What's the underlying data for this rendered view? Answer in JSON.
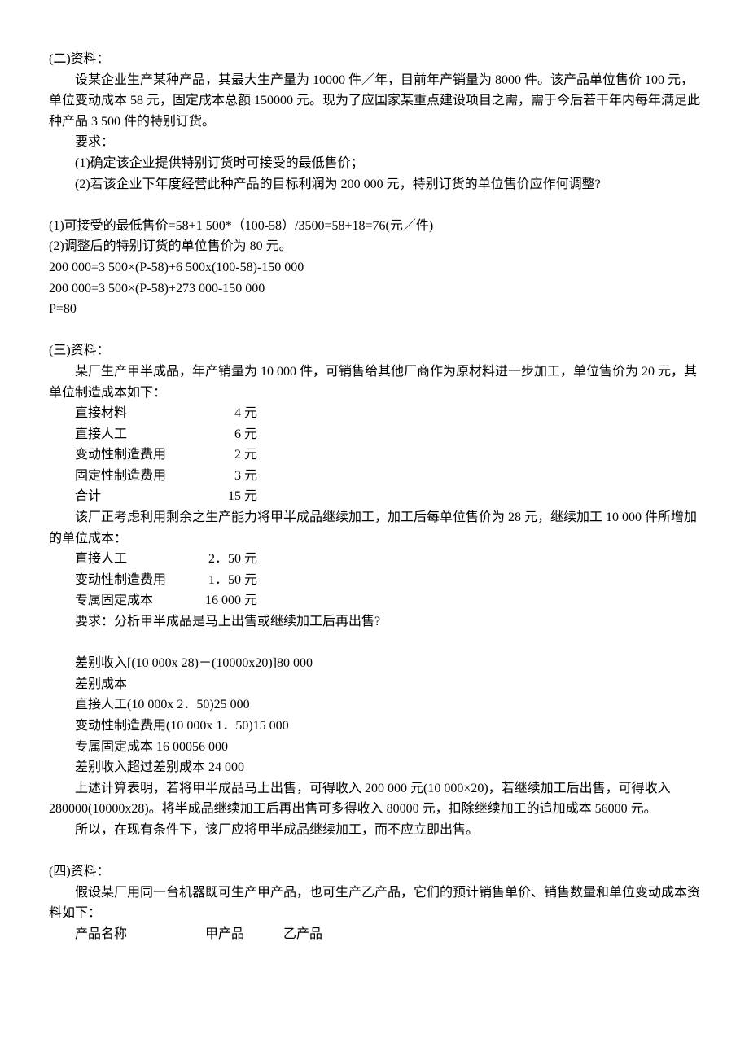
{
  "s2": {
    "title": "(二)资料：",
    "p1": "设某企业生产某种产品，其最大生产量为 10000 件／年，目前年产销量为 8000 件。该产品单位售价 100 元，单位变动成本 58 元，固定成本总额 150000 元。现为了应国家某重点建设项目之需，需于今后若干年内每年满足此种产品 3 500 件的特别订货。",
    "req": "要求：",
    "r1": "(1)确定该企业提供特别订货时可接受的最低售价；",
    "r2": "(2)若该企业下年度经营此种产品的目标利润为 200 000 元，特别订货的单位售价应作何调整?",
    "a1": "(1)可接受的最低售价=58+1 500*（100-58）/3500=58+18=76(元／件)",
    "a2": "(2)调整后的特别订货的单位售价为 80 元。",
    "a3": "200 000=3 500×(P-58)+6 500x(100-58)-150 000",
    "a4": "200 000=3 500×(P-58)+273 000-150 000",
    "a5": "P=80"
  },
  "s3": {
    "title": "(三)资料：",
    "p1": "某厂生产甲半成品，年产销量为 10 000 件，可销售给其他厂商作为原材料进一步加工，单位售价为 20 元，其单位制造成本如下：",
    "cost1": [
      {
        "label": "直接材料",
        "val": "4 元"
      },
      {
        "label": "直接人工",
        "val": "6 元"
      },
      {
        "label": "变动性制造费用",
        "val": "2 元"
      },
      {
        "label": "固定性制造费用",
        "val": "3 元"
      },
      {
        "label": "合计",
        "val": "15 元"
      }
    ],
    "p2": "该厂正考虑利用剩余之生产能力将甲半成品继续加工，加工后每单位售价为 28 元，继续加工 10 000 件所增加的单位成本：",
    "cost2": [
      {
        "label": "直接人工",
        "val": "2．50 元"
      },
      {
        "label": "变动性制造费用",
        "val": "1．50 元"
      },
      {
        "label": "专属固定成本",
        "val": "16 000 元"
      }
    ],
    "req": "要求：分析甲半成品是马上出售或继续加工后再出售?",
    "a1": "差别收入[(10 000x 28)－(10000x20)]80 000",
    "a2": "差别成本",
    "a3": "直接人工(10 000x 2．50)25 000",
    "a4": "变动性制造费用(10 000x 1．50)15 000",
    "a5": "专属固定成本 16 00056 000",
    "a6": "差别收入超过差别成本 24 000",
    "a7": "上述计算表明，若将甲半成品马上出售，可得收入 200 000 元(10 000×20)，若继续加工后出售，可得收入280000(10000x28)。将半成品继续加工后再出售可多得收入 80000 元，扣除继续加工的追加成本 56000 元。",
    "a8": "所以，在现有条件下，该厂应将甲半成品继续加工，而不应立即出售。"
  },
  "s4": {
    "title": "(四)资料：",
    "p1": "假设某厂用同一台机器既可生产甲产品，也可生产乙产品，它们的预计销售单价、销售数量和单位变动成本资料如下：",
    "head": {
      "a": "产品名称",
      "b": "甲产品",
      "c": "乙产品"
    }
  }
}
